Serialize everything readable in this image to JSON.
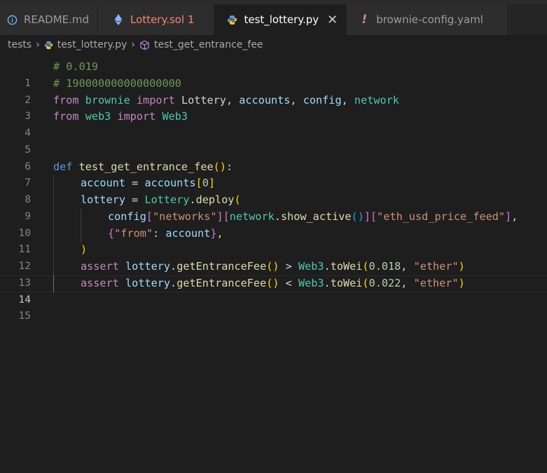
{
  "tabs": [
    {
      "label": "README.md",
      "icon": "info-icon"
    },
    {
      "label": "Lottery.sol 1",
      "icon": "ethereum-icon"
    },
    {
      "label": "test_lottery.py",
      "icon": "python-icon",
      "close": "✕"
    },
    {
      "label": "brownie-config.yaml",
      "icon": "exclamation-icon"
    }
  ],
  "breadcrumb": {
    "folder": "tests",
    "file": "test_lottery.py",
    "symbol": "test_get_entrance_fee"
  },
  "editor": {
    "current_line": 14,
    "line_numbers": [
      "1",
      "2",
      "3",
      "4",
      "5",
      "6",
      "7",
      "8",
      "9",
      "10",
      "11",
      "12",
      "13",
      "14",
      "15"
    ],
    "l1": {
      "comment": "# 0.019"
    },
    "l2": {
      "comment": "# 190000000000000000"
    },
    "l3": {
      "from": "from",
      "module": "brownie",
      "import": "import",
      "name1": "Lottery",
      "c1": ",",
      "name2": "accounts",
      "c2": ",",
      "name3": "config",
      "c3": ",",
      "name4": "network"
    },
    "l4": {
      "from": "from",
      "module": "web3",
      "import": "import",
      "name1": "Web3"
    },
    "l7": {
      "def": "def",
      "fname": "test_get_entrance_fee",
      "open": "(",
      "close": ")",
      "colon": ":"
    },
    "l8": {
      "var": "account",
      "eq": " = ",
      "src": "accounts",
      "open": "[",
      "num": "0",
      "close": "]"
    },
    "l9": {
      "var": "lottery",
      "eq": " = ",
      "cls": "Lottery",
      "dot": ".",
      "meth": "deploy",
      "open": "("
    },
    "l10": {
      "var": "config",
      "o1": "[",
      "s1": "\"networks\"",
      "c1": "]",
      "o2": "[",
      "v2": "network",
      "dot": ".",
      "meth": "show_active",
      "p1": "(",
      "p2": ")",
      "c2": "]",
      "o3": "[",
      "s3": "\"eth_usd_price_feed\"",
      "c3": "]",
      "comma": ","
    },
    "l11": {
      "open": "{",
      "key": "\"from\"",
      "colon": ": ",
      "val": "account",
      "close": "}",
      "comma": ","
    },
    "l12": {
      "close": ")"
    },
    "l13": {
      "kw": "assert",
      "var": "lottery",
      "dot": ".",
      "meth": "getEntranceFee",
      "p1": "(",
      "p2": ")",
      "op": " > ",
      "cls": "Web3",
      "dot2": ".",
      "meth2": "toWei",
      "o": "(",
      "num": "0.018",
      "comma": ", ",
      "str": "\"ether\"",
      "c": ")"
    },
    "l14": {
      "kw": "assert",
      "var": "lottery",
      "dot": ".",
      "meth": "getEntranceFee",
      "p1": "(",
      "p2": ")",
      "op": " < ",
      "cls": "Web3",
      "dot2": ".",
      "meth2": "toWei",
      "o": "(",
      "num": "0.022",
      "comma": ", ",
      "str": "\"ether\"",
      "c": ")"
    }
  }
}
